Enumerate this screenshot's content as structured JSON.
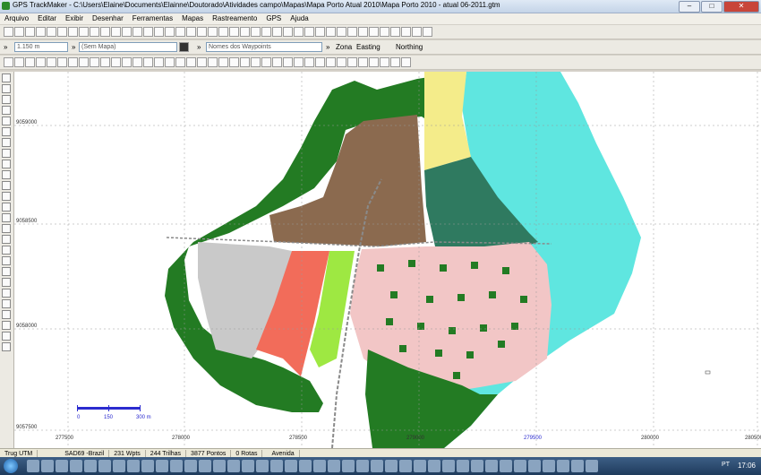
{
  "window": {
    "title": "GPS TrackMaker - C:\\Users\\Elaine\\Documents\\Elainne\\Doutorado\\Atividades campo\\Mapas\\Mapa Porto Atual 2010\\Mapa Porto 2010 - atual 06-2011.gtm"
  },
  "menu": [
    "Arquivo",
    "Editar",
    "Exibir",
    "Desenhar",
    "Ferramentas",
    "Mapas",
    "Rastreamento",
    "GPS",
    "Ajuda"
  ],
  "toolbar2": {
    "scale_value": "1.150 m",
    "map_field": "(Sem Mapa)",
    "waypoints_field": "Nomes dos Waypoints",
    "zona_label": "Zona",
    "easting_label": "Easting",
    "northing_label": "Northing"
  },
  "map": {
    "y_ticks": [
      "9059000",
      "9058500",
      "9058000",
      "9057500"
    ],
    "x_ticks": [
      "277500",
      "278000",
      "278500",
      "279000",
      "279500",
      "280000",
      "280500"
    ],
    "scalebar": {
      "labels": [
        "0",
        "150",
        "300 m"
      ]
    }
  },
  "status": [
    "Trug UTM",
    "SAD69 -Brazil",
    "231 Wpts",
    "244 Trilhas",
    "3877 Pontos",
    "0 Rotas",
    "Avenida"
  ],
  "taskbar": {
    "language": "PT",
    "time": "17:06"
  },
  "colors": {
    "water": "#5fe6e0",
    "forest": "#237b23",
    "brown": "#8b6a4f",
    "teal": "#2f7a60",
    "yellow": "#f4ec8a",
    "pink": "#f2c6c6",
    "gray": "#c9c9c9",
    "salmon": "#f26c5a",
    "lightgreen": "#9ee842"
  }
}
